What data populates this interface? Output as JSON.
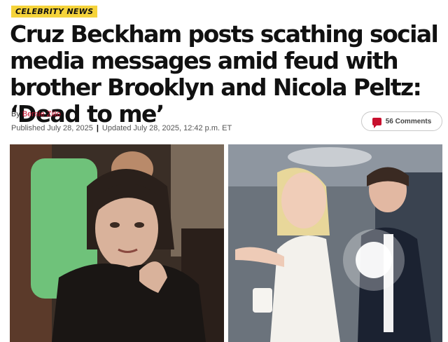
{
  "category_label": "CELEBRITY NEWS",
  "headline": "Cruz Beckham posts scathing social media messages amid feud with brother Brooklyn and Nicola Peltz: ‘Dead to me’",
  "byline": {
    "prefix": "By ",
    "author": "Bernie Zilio"
  },
  "meta": {
    "published": "Published July 28, 2025",
    "separator": "|",
    "updated": "Updated July 28, 2025, 12:42 p.m. ET"
  },
  "comments": {
    "label": "56 Comments",
    "icon": "comment-bubble-icon"
  },
  "colors": {
    "accent": "#c8102e",
    "category_bg": "#f5d33a"
  }
}
